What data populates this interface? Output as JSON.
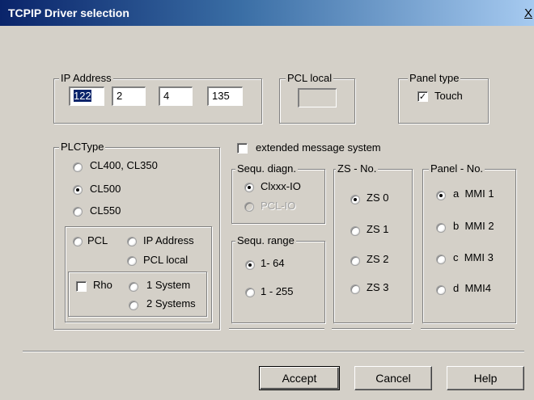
{
  "window": {
    "title": "TCPIP Driver selection",
    "close_glyph": "X"
  },
  "ip_address": {
    "label": "IP Address",
    "octets": [
      "122",
      "2",
      "4",
      "135"
    ]
  },
  "pcl_local": {
    "label": "PCL local",
    "value": ""
  },
  "panel_type": {
    "label": "Panel type",
    "touch_label": "Touch",
    "touch_checked": true
  },
  "plc_type": {
    "label": "PLCType",
    "options": [
      {
        "label": "CL400, CL350",
        "selected": false
      },
      {
        "label": "CL500",
        "selected": true
      },
      {
        "label": "CL550",
        "selected": false
      }
    ],
    "pcl_label": "PCL",
    "ip_address_label": "IP Address",
    "pcl_local_label": "PCL local",
    "rho_label": "Rho",
    "one_system_label": "1 System",
    "two_systems_label": "2 Systems"
  },
  "extended_message": {
    "label": "extended message system",
    "checked": false
  },
  "sequ_diagn": {
    "label": "Sequ. diagn.",
    "options": [
      {
        "label": "Clxxx-IO",
        "selected": true,
        "disabled": false
      },
      {
        "label": "PCL-IO",
        "selected": false,
        "disabled": true
      }
    ]
  },
  "sequ_range": {
    "label": "Sequ. range",
    "options": [
      {
        "label": "1- 64",
        "selected": true
      },
      {
        "label": "1 - 255",
        "selected": false
      }
    ]
  },
  "zs_no": {
    "label": "ZS - No.",
    "options": [
      {
        "label": "ZS 0",
        "selected": true
      },
      {
        "label": "ZS 1",
        "selected": false
      },
      {
        "label": "ZS 2",
        "selected": false
      },
      {
        "label": "ZS 3",
        "selected": false
      }
    ]
  },
  "panel_no": {
    "label": "Panel - No.",
    "options": [
      {
        "label": "a  MMI 1",
        "selected": true
      },
      {
        "label": "b  MMI 2",
        "selected": false
      },
      {
        "label": "c  MMI 3",
        "selected": false
      },
      {
        "label": "d  MMI4",
        "selected": false
      }
    ]
  },
  "buttons": {
    "accept": "Accept",
    "cancel": "Cancel",
    "help": "Help"
  }
}
